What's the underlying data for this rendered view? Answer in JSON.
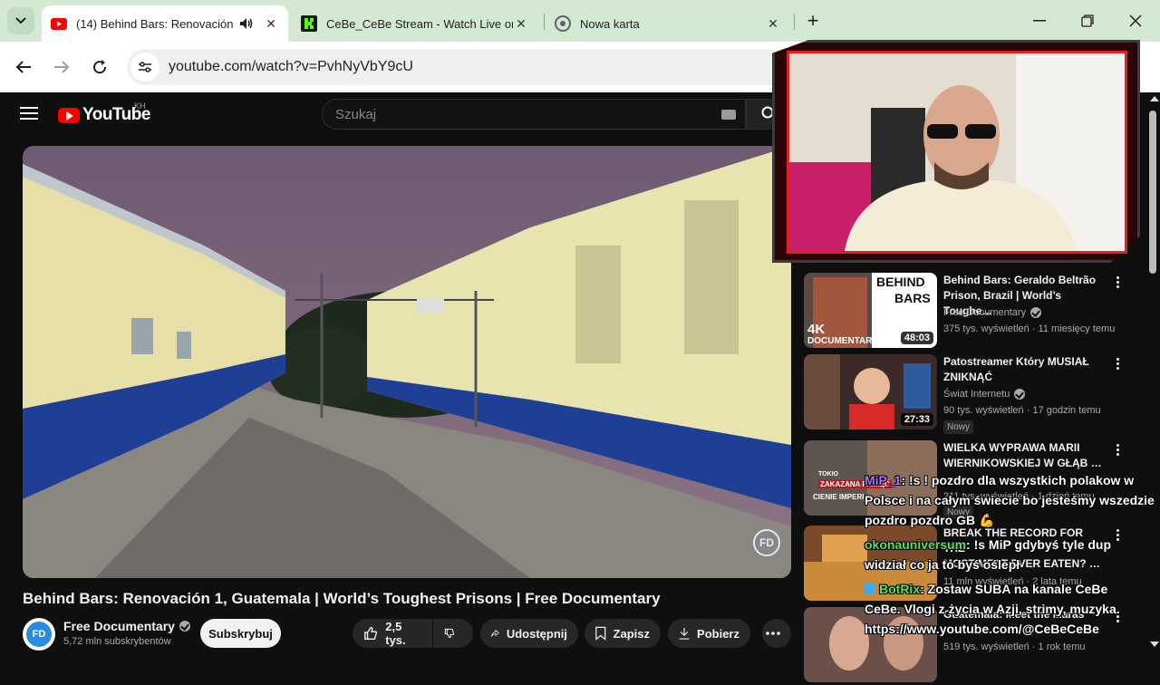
{
  "browser": {
    "tabs": [
      {
        "title": "(14) Behind Bars: Renovación",
        "favicon": "youtube-icon",
        "audio": true
      },
      {
        "title": "CeBe_CeBe Stream - Watch Live on",
        "favicon": "kick-icon"
      },
      {
        "title": "Nowa karta",
        "favicon": "chrome-icon"
      }
    ],
    "url": "youtube.com/watch?v=PvhNyVbY9cU"
  },
  "youtube": {
    "logo_text": "YouTube",
    "region": "KH",
    "search_placeholder": "Szukaj"
  },
  "video": {
    "title": "Behind Bars: Renovación 1, Guatemala | World’s Toughest Prisons | Free Documentary",
    "watermark": "FD",
    "channel": {
      "name": "Free Documentary",
      "avatar": "FD",
      "subscribers": "5,72 mln subskrybentów"
    },
    "subscribe_label": "Subskrybuj",
    "likes": "2,5 tys.",
    "share_label": "Udostępnij",
    "save_label": "Zapisz",
    "download_label": "Pobierz"
  },
  "recommendations": [
    {
      "title_1": "Behind Bars: Geraldo Beltrão",
      "title_2": "Prison, Brazil | World’s Toughe…",
      "channel": "Free Documentary",
      "verified": true,
      "meta": "375 tys. wyświetleń · 11 miesięcy temu",
      "duration": "48:03",
      "thumb_text_1": "BEHIND",
      "thumb_text_2": "BARS",
      "thumb_text_3": "4K",
      "thumb_text_4": "DOCUMENTARY"
    },
    {
      "title_1": "Patostreamer Który MUSIAŁ",
      "title_2": "ZNIKNĄĆ",
      "channel": "Świat Internetu",
      "verified": true,
      "meta": "90 tys. wyświetleń · 17 godzin temu",
      "duration": "27:33",
      "badge": "Nowy"
    },
    {
      "title_1": "WIELKA WYPRAWA MARII",
      "title_2": "WIERNIKOWSKIEJ W GŁĄB …",
      "meta": "211 tys. wyświetleń · 1 dzień temu",
      "badge": "Nowy",
      "thumb_text_1": "TOKIO",
      "thumb_text_2": "ZAKAZANA PAMIĘĆ",
      "thumb_text_3": "CIENIE IMPERI"
    },
    {
      "title_1": "BREAK THE RECORD FOR THE",
      "title_2": "MOST MEAT EVER EATEN? …",
      "meta": "11 mln wyświetleń · 2 lata temu"
    },
    {
      "title_1": "Guatemala: Meet the Maras",
      "meta": "519 tys. wyświetleń · 1 rok temu"
    }
  ],
  "chat": [
    {
      "user": "MiP_1",
      "user_color": "#b070ff",
      "line_1": ": !s ! pozdro dla wszystkich polakow w",
      "line_2": "Polsce i na całym świecie bo jesteśmy wszedzie",
      "line_3": "pozdro pozdro GB 💪"
    },
    {
      "user": "okonauniversum",
      "user_color": "#5de05d",
      "line_1": ": !s MiP gdybyś tyle dup",
      "line_2": "widział co ja to byś oślepł"
    },
    {
      "user": "BotRix",
      "user_color": "#5de05d",
      "line_1": ": Zostaw SUBA na kanale CeBe",
      "line_2": "CeBe. Vlogi z życia w Azji, strimy, muzyka.",
      "line_3": "https://www.youtube.com/@CeBeCeBe"
    }
  ]
}
